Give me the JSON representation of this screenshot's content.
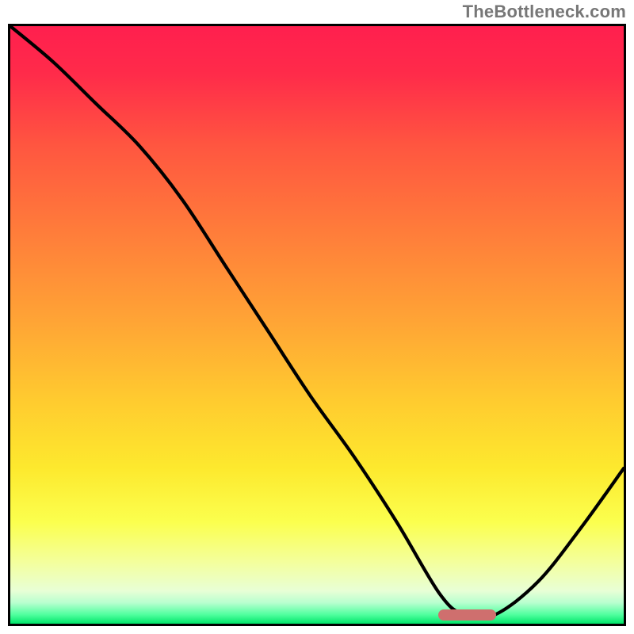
{
  "watermark": "TheBottleneck.com",
  "plot": {
    "inner_width": 774,
    "inner_height": 754
  },
  "gradient_stops": [
    {
      "offset": 0,
      "color": "#ff1f4e"
    },
    {
      "offset": 0.08,
      "color": "#ff2b4a"
    },
    {
      "offset": 0.2,
      "color": "#ff5640"
    },
    {
      "offset": 0.35,
      "color": "#ff7e3a"
    },
    {
      "offset": 0.5,
      "color": "#ffa635"
    },
    {
      "offset": 0.63,
      "color": "#ffcc2f"
    },
    {
      "offset": 0.74,
      "color": "#fde92e"
    },
    {
      "offset": 0.83,
      "color": "#fbff4e"
    },
    {
      "offset": 0.9,
      "color": "#f3ffa0"
    },
    {
      "offset": 0.945,
      "color": "#e8ffd6"
    },
    {
      "offset": 0.965,
      "color": "#b8ffcf"
    },
    {
      "offset": 0.985,
      "color": "#4fff9e"
    },
    {
      "offset": 1.0,
      "color": "#00e56a"
    }
  ],
  "marker": {
    "x_frac_center": 0.745,
    "width_frac": 0.095,
    "y_frac_center": 0.985,
    "color": "#cf6f6e"
  },
  "chart_data": {
    "type": "line",
    "title": "",
    "xlabel": "",
    "ylabel": "",
    "xlim": [
      0,
      1
    ],
    "ylim": [
      0,
      1
    ],
    "note": "Axes have no tick labels; values are fractional positions estimated from the image. y represents relative bottleneck (1 = top/red, 0 = bottom/green).",
    "series": [
      {
        "name": "bottleneck-curve",
        "x": [
          0.0,
          0.07,
          0.14,
          0.21,
          0.28,
          0.35,
          0.42,
          0.49,
          0.56,
          0.63,
          0.7,
          0.74,
          0.79,
          0.86,
          0.93,
          1.0
        ],
        "y": [
          1.0,
          0.94,
          0.87,
          0.8,
          0.71,
          0.6,
          0.49,
          0.38,
          0.28,
          0.17,
          0.05,
          0.015,
          0.015,
          0.07,
          0.16,
          0.26
        ]
      }
    ],
    "flat_minimum_marker": {
      "x_start": 0.7,
      "x_end": 0.79,
      "y": 0.015
    }
  }
}
